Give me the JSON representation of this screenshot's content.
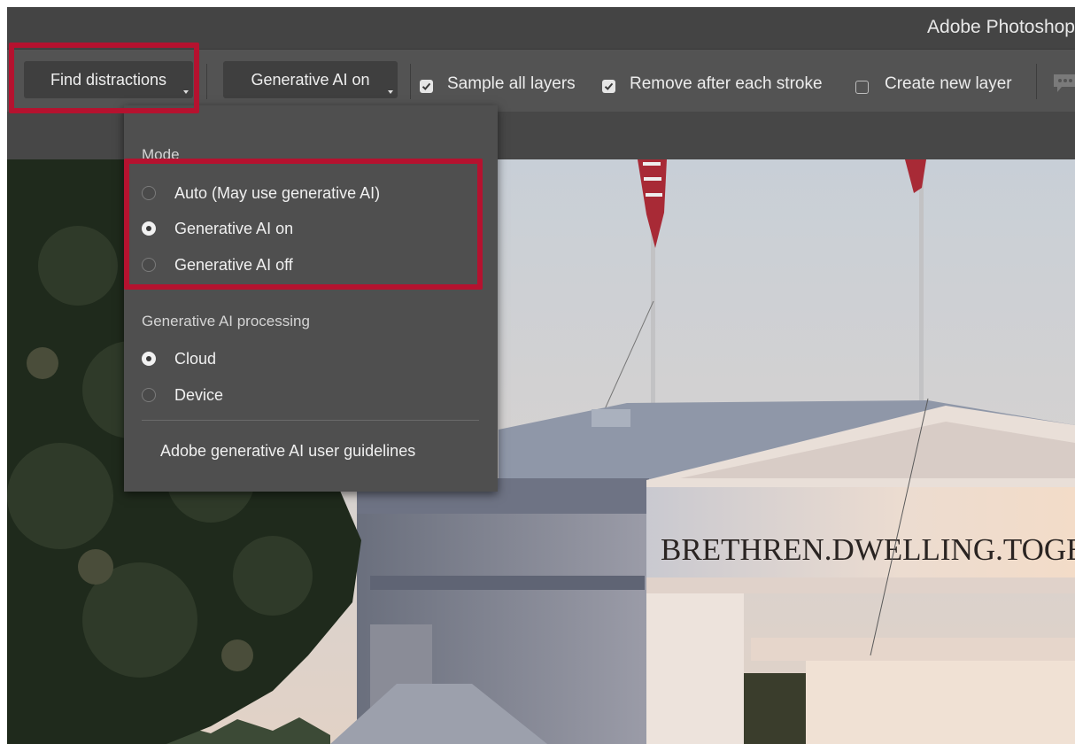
{
  "app": {
    "title": "Adobe Photoshop"
  },
  "options_bar": {
    "find_distractions_label": "Find distractions",
    "mode_button_label": "Generative AI on",
    "sample_all_layers_label": "Sample all layers",
    "sample_all_layers_checked": true,
    "remove_after_each_stroke_label": "Remove after each stroke",
    "remove_after_each_stroke_checked": true,
    "create_new_layer_label": "Create new layer",
    "create_new_layer_checked": false
  },
  "mode_menu": {
    "mode_header": "Mode",
    "mode_options": [
      {
        "label": "Auto (May use generative AI)",
        "selected": false
      },
      {
        "label": "Generative AI on",
        "selected": true
      },
      {
        "label": "Generative AI off",
        "selected": false
      }
    ],
    "processing_header": "Generative AI processing",
    "processing_options": [
      {
        "label": "Cloud",
        "selected": true
      },
      {
        "label": "Device",
        "selected": false
      }
    ],
    "guidelines_link": "Adobe generative AI user guidelines"
  },
  "photo": {
    "inscription": "BRETHREN.DWELLING.TOGETHER."
  },
  "colors": {
    "highlight": "#b5122f",
    "dropdown_bg": "#4f4f4f",
    "toolbar_bg": "#535353"
  },
  "icons": [
    "checkmark-icon",
    "dropdown-triangle-icon",
    "chat-bubble-icon"
  ]
}
